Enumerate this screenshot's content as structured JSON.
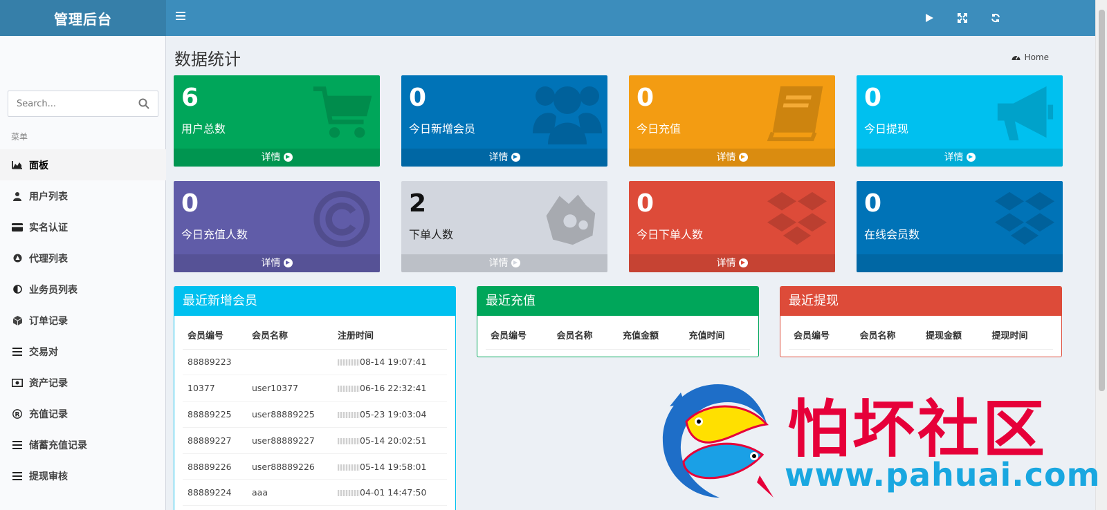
{
  "header": {
    "logo": "管理后台",
    "icons": [
      "play-icon",
      "fullscreen-icon",
      "refresh-icon"
    ]
  },
  "sidebar": {
    "search_placeholder": "Search...",
    "menu_header": "菜单",
    "items": [
      {
        "label": "面板",
        "icon": "area-chart-icon",
        "active": true
      },
      {
        "label": "用户列表",
        "icon": "user-icon"
      },
      {
        "label": "实名认证",
        "icon": "credit-card-icon"
      },
      {
        "label": "代理列表",
        "icon": "circle-icon"
      },
      {
        "label": "业务员列表",
        "icon": "half-circle-icon"
      },
      {
        "label": "订单记录",
        "icon": "cube-icon"
      },
      {
        "label": "交易对",
        "icon": "bars-icon"
      },
      {
        "label": "资产记录",
        "icon": "money-icon"
      },
      {
        "label": "充值记录",
        "icon": "registered-icon"
      },
      {
        "label": "储蓄充值记录",
        "icon": "bars-icon"
      },
      {
        "label": "提现审核",
        "icon": "bars-icon"
      }
    ]
  },
  "page": {
    "title": "数据统计",
    "breadcrumb": "Home"
  },
  "stats": [
    {
      "value": "6",
      "label": "用户总数",
      "footer": "详情",
      "color": "#00a65a",
      "icon": "cart-icon"
    },
    {
      "value": "0",
      "label": "今日新增会员",
      "footer": "详情",
      "color": "#0073b7",
      "icon": "users-icon"
    },
    {
      "value": "0",
      "label": "今日充值",
      "footer": "详情",
      "color": "#f39c12",
      "icon": "book-icon"
    },
    {
      "value": "0",
      "label": "今日提现",
      "footer": "详情",
      "color": "#00c0ef",
      "icon": "bullhorn-icon"
    },
    {
      "value": "0",
      "label": "今日充值人数",
      "footer": "详情",
      "color": "#605ca8",
      "icon": "copyright-icon"
    },
    {
      "value": "2",
      "label": "下单人数",
      "footer": "详情",
      "color": "#d2d6de",
      "icon": "sign-language-icon"
    },
    {
      "value": "0",
      "label": "今日下单人数",
      "footer": "详情",
      "color": "#dd4b39",
      "icon": "dropbox-icon"
    },
    {
      "value": "0",
      "label": "在线会员数",
      "footer": "",
      "color": "#0073b7",
      "icon": "dropbox-icon"
    }
  ],
  "panels": {
    "members": {
      "title": "最近新增会员",
      "color": "#00c0ef",
      "headers": [
        "会员编号",
        "会员名称",
        "注册时间"
      ],
      "rows": [
        [
          "88889223",
          "",
          "08-14 19:07:41"
        ],
        [
          "10377",
          "user10377",
          "06-16 22:32:41"
        ],
        [
          "88889225",
          "user88889225",
          "05-23 19:03:04"
        ],
        [
          "88889227",
          "user88889227",
          "05-14 20:02:51"
        ],
        [
          "88889226",
          "user88889226",
          "05-14 19:58:01"
        ],
        [
          "88889224",
          "aaa",
          "04-01 14:47:50"
        ]
      ]
    },
    "recharge": {
      "title": "最近充值",
      "color": "#00a65a",
      "headers": [
        "会员编号",
        "会员名称",
        "充值金额",
        "充值时间"
      ]
    },
    "withdraw": {
      "title": "最近提现",
      "color": "#dd4b39",
      "headers": [
        "会员编号",
        "会员名称",
        "提现金额",
        "提现时间"
      ]
    }
  },
  "watermark": {
    "text": "怕坏社区",
    "url": "www.pahuai.com"
  }
}
